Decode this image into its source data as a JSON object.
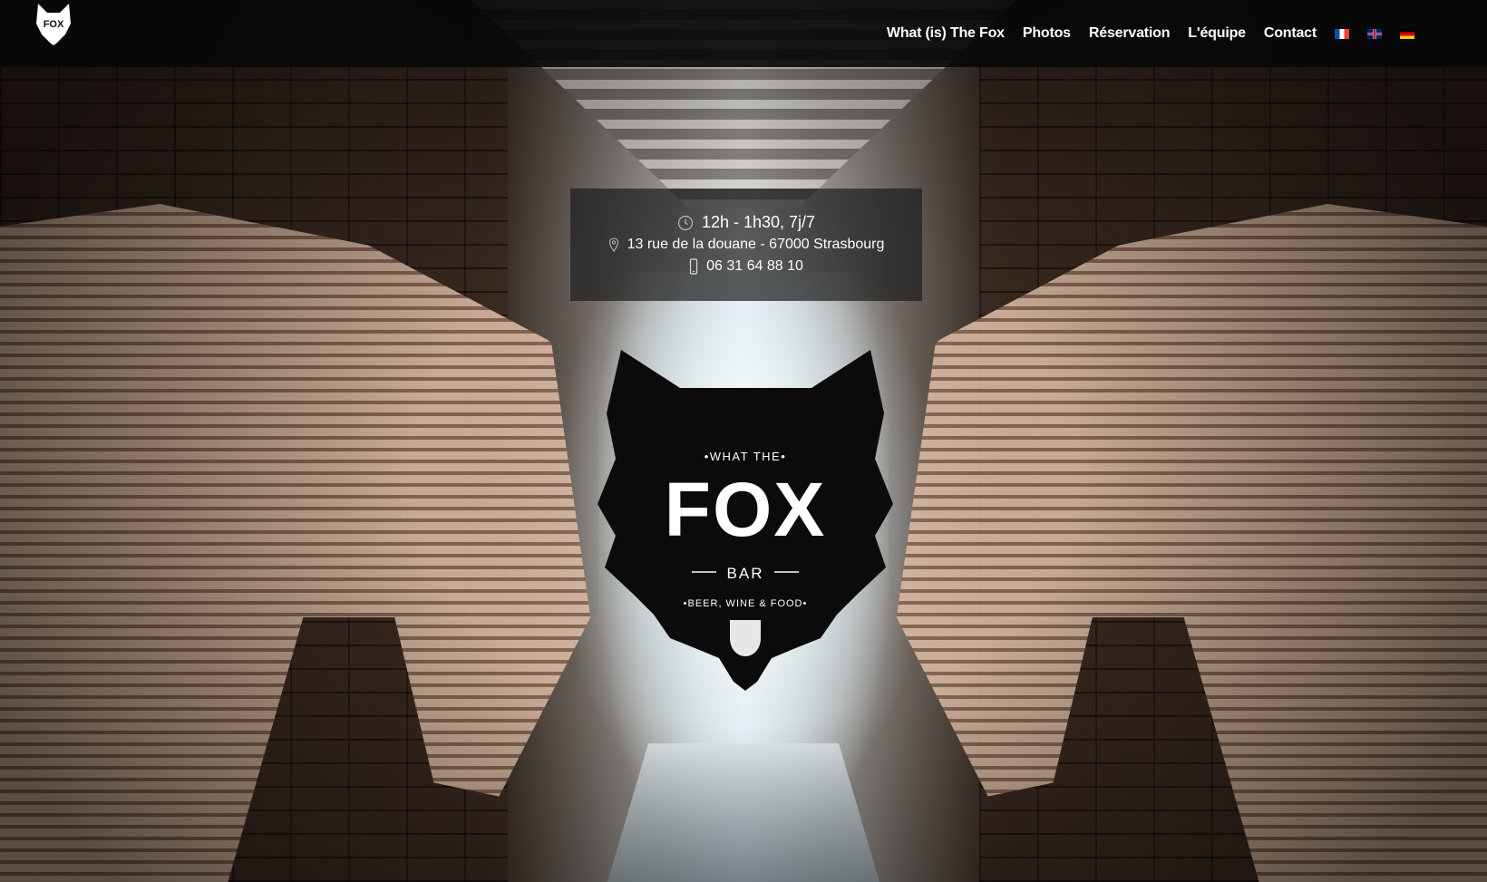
{
  "header": {
    "logo_text": "FOX",
    "nav": [
      {
        "label": "What (is) The Fox"
      },
      {
        "label": "Photos"
      },
      {
        "label": "Réservation"
      },
      {
        "label": "L'équipe"
      },
      {
        "label": "Contact"
      }
    ],
    "flags": [
      {
        "icon": "flag-fr-icon",
        "colors": [
          "#0055a4",
          "#ffffff",
          "#ef4135"
        ]
      },
      {
        "icon": "flag-en-icon",
        "colors": [
          "#012169",
          "#ffffff",
          "#c8102e"
        ]
      },
      {
        "icon": "flag-de-icon",
        "colors": [
          "#000000",
          "#dd0000",
          "#ffce00"
        ]
      }
    ]
  },
  "info": {
    "hours": "12h - 1h30, 7j/7",
    "address": "13 rue de la douane - 67000 Strasbourg",
    "phone": "06 31 64 88 10",
    "icons": [
      "clock-icon",
      "map-pin-icon",
      "mobile-phone-icon"
    ]
  },
  "hero_logo": {
    "top_text": "•WHAT THE•",
    "main_text": "FOX",
    "sub_text": "BAR",
    "bottom_text": "•BEER, WINE & FOOD•"
  },
  "colors": {
    "header_bg": "#080808",
    "text": "#ffffff",
    "info_bg": "#1e1e1e"
  }
}
